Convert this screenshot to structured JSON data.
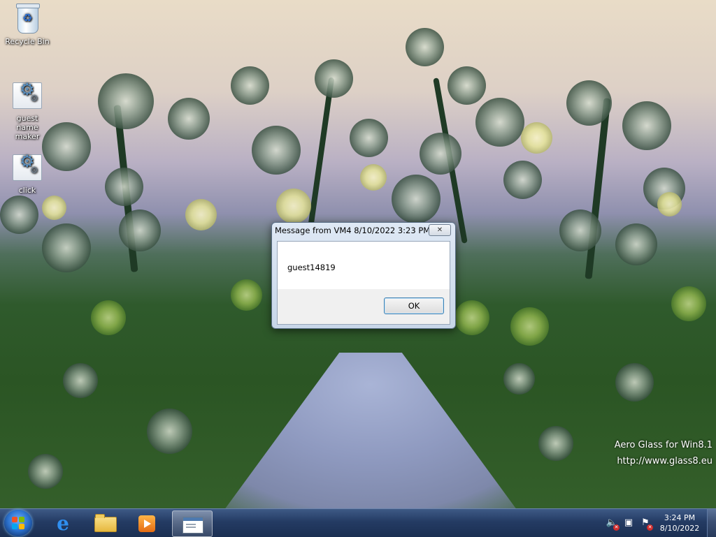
{
  "desktop": {
    "icons": [
      {
        "label": "Recycle Bin",
        "icon": "recycle-bin-icon"
      },
      {
        "label": "guest name maker",
        "icon": "application-icon"
      },
      {
        "label": "click",
        "icon": "application-icon"
      }
    ],
    "watermark": {
      "line1": "Aero Glass for Win8.1",
      "line2": "http://www.glass8.eu"
    }
  },
  "dialog": {
    "title": "Message from VM4 8/10/2022 3:23 PM",
    "close_label": "✕",
    "message": "guest14819",
    "ok_label": "OK"
  },
  "taskbar": {
    "pinned": [
      {
        "name": "internet-explorer",
        "icon": "ie-icon"
      },
      {
        "name": "file-explorer",
        "icon": "folder-icon"
      },
      {
        "name": "media-player",
        "icon": "media-player-icon"
      },
      {
        "name": "message-window",
        "icon": "window-icon",
        "active": true
      }
    ],
    "tray": {
      "volume": "muted",
      "network": "disconnected",
      "flag": "action-center-alert"
    },
    "clock": {
      "time": "3:24 PM",
      "date": "8/10/2022"
    }
  },
  "colors": {
    "taskbar": "#243b63",
    "dialog_frame": "#c7d6e8",
    "ok_border": "#3c7fb1",
    "tray_alert": "#d12b2b"
  }
}
